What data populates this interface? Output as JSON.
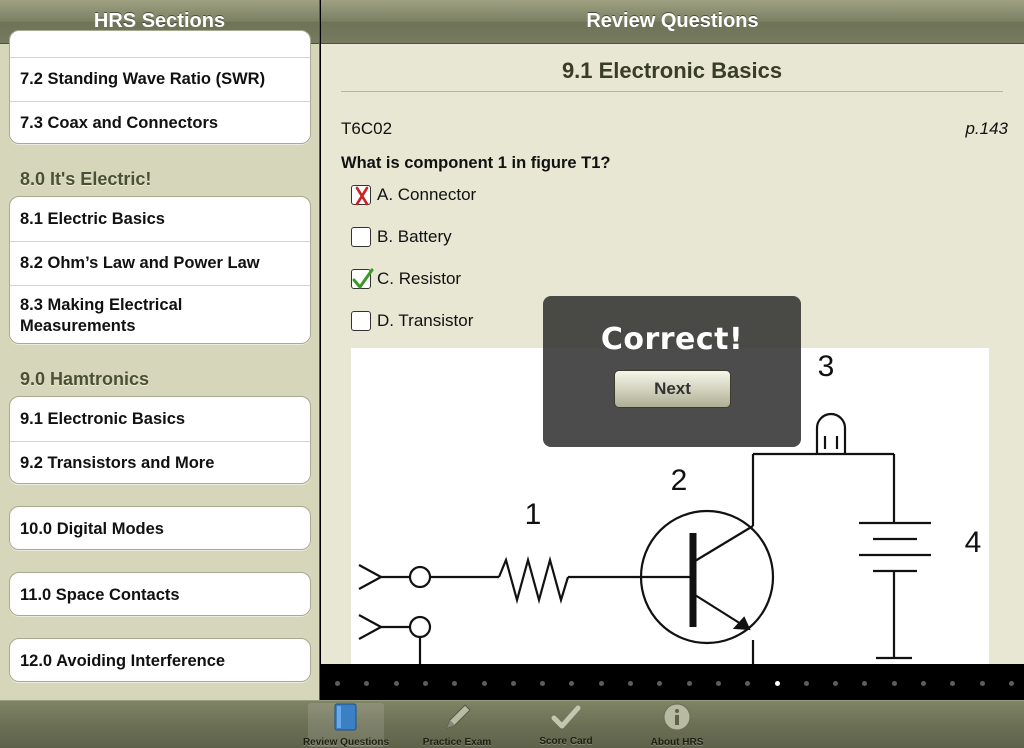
{
  "left": {
    "title": "HRS Sections",
    "items": {
      "s72": "7.2 Standing Wave Ratio (SWR)",
      "s73": "7.3 Coax and Connectors",
      "h80": "8.0 It's Electric!",
      "s81": "8.1 Electric Basics",
      "s82": "8.2 Ohm’s Law and Power Law",
      "s83": "8.3 Making Electrical Measurements",
      "h90": "9.0 Hamtronics",
      "s91": "9.1 Electronic Basics",
      "s92": "9.2 Transistors and More",
      "s100": "10.0 Digital Modes",
      "s110": "11.0 Space Contacts",
      "s120": "12.0 Avoiding Interference"
    }
  },
  "right": {
    "title": "Review Questions",
    "section_title": "9.1 Electronic Basics",
    "question_id": "T6C02",
    "page_ref": "p.143",
    "question": "What is component 1 in figure T1?",
    "answers": {
      "a": {
        "label": "A. Connector",
        "state": "wrong"
      },
      "b": {
        "label": "B. Battery",
        "state": "empty"
      },
      "c": {
        "label": "C. Resistor",
        "state": "correct"
      },
      "d": {
        "label": "D. Transistor",
        "state": "empty"
      }
    },
    "figure": {
      "label1": "1",
      "label2": "2",
      "label3": "3",
      "label4": "4"
    },
    "overlay": {
      "message": "Correct!",
      "next_label": "Next"
    },
    "pager": {
      "count": 24,
      "current": 15
    }
  },
  "tabs": {
    "review": "Review Questions",
    "practice": "Practice Exam",
    "score": "Score Card",
    "about": "About HRS"
  },
  "colors": {
    "correct": "#3a9a24",
    "wrong": "#cc2222",
    "toolbar": "#767a5e",
    "panel_bg": "#d6d6ba",
    "content_bg": "#e7e7d3"
  }
}
